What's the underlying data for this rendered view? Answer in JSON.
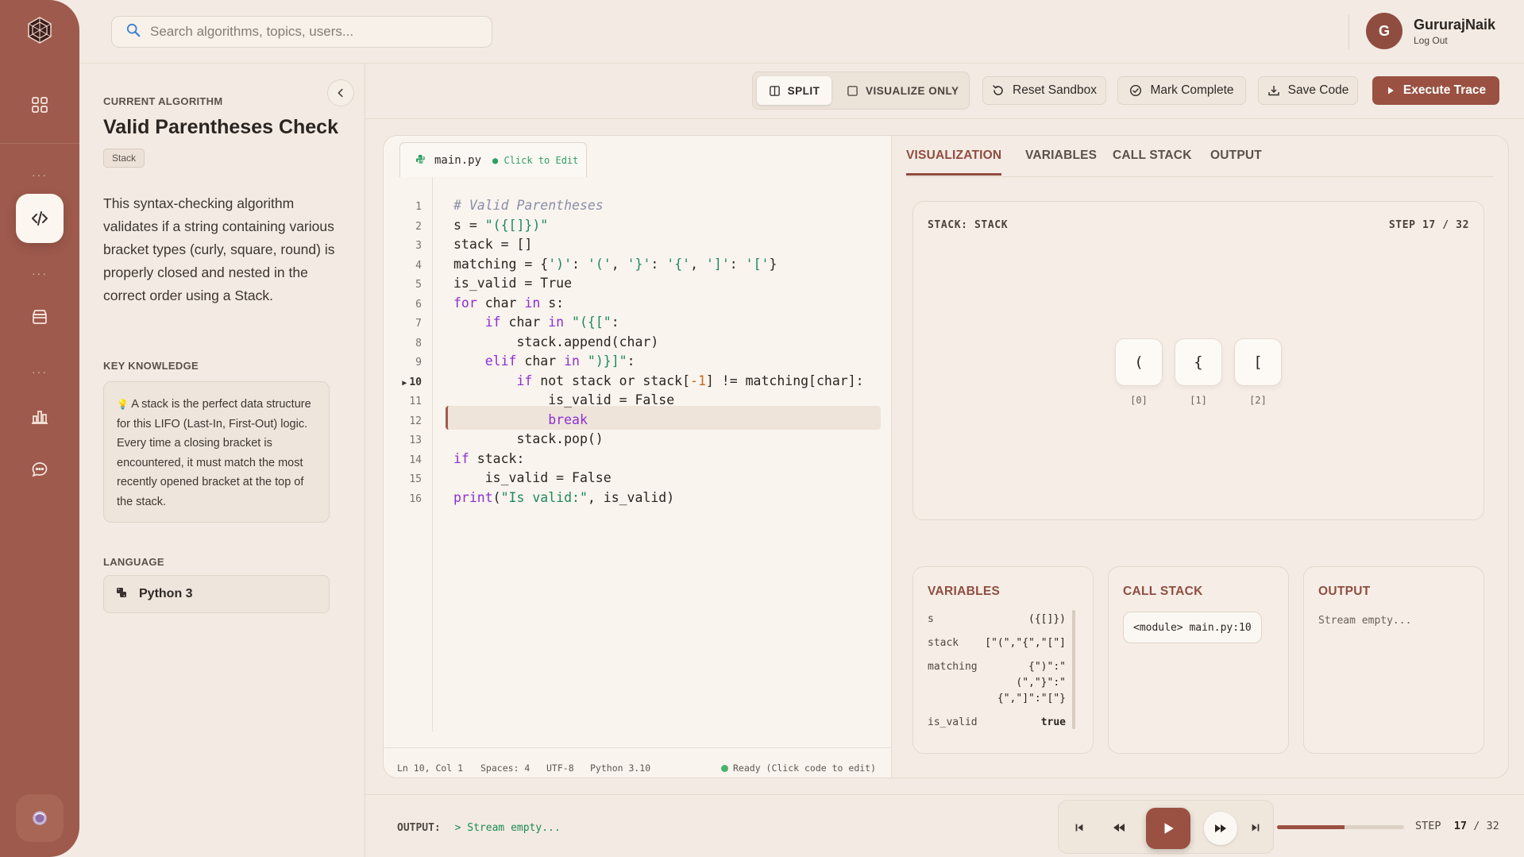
{
  "search": {
    "placeholder": "Search algorithms, topics, users..."
  },
  "user": {
    "initial": "G",
    "name": "GururajNaik",
    "action": "Log Out"
  },
  "sidebar": {
    "items": [
      "dashboard-icon",
      "code-icon",
      "archive-icon",
      "chart-icon",
      "chat-icon",
      "profile-icon"
    ],
    "dots": "···"
  },
  "left_panel": {
    "current_label": "CURRENT ALGORITHM",
    "title": "Valid Parentheses Check",
    "tag": "Stack",
    "description": "This syntax-checking algorithm validates if a string containing various bracket types (curly, square, round) is properly closed and nested in the correct order using a Stack.",
    "knowledge_label": "KEY KNOWLEDGE",
    "knowledge_icon": "💡",
    "knowledge_text": "A stack is the perfect data structure for this LIFO (Last-In, First-Out) logic. Every time a closing bracket is encountered, it must match the most recently opened bracket at the top of the stack.",
    "language_label": "LANGUAGE",
    "language": "Python 3"
  },
  "toolbar": {
    "split": "SPLIT",
    "visualize_only": "VISUALIZE ONLY",
    "reset": "Reset Sandbox",
    "mark_complete": "Mark Complete",
    "save": "Save Code",
    "execute": "Execute Trace"
  },
  "editor": {
    "filename": "main.py",
    "edit_hint": "● Click to Edit",
    "current_line": 10,
    "status": {
      "position": "Ln 10, Col 1",
      "spaces": "Spaces: 4",
      "encoding": "UTF-8",
      "version": "Python 3.10",
      "ready": "Ready (Click code to edit)"
    }
  },
  "viz": {
    "tabs": [
      "VISUALIZATION",
      "VARIABLES",
      "CALL STACK",
      "OUTPUT"
    ],
    "stack_title": "STACK: STACK",
    "step_label": "STEP 17 / 32",
    "stack_items": [
      "(",
      "{",
      "["
    ],
    "stack_indices": [
      "[0]",
      "[1]",
      "[2]"
    ]
  },
  "variables": {
    "title": "VARIABLES",
    "rows": [
      {
        "name": "s",
        "value": "({[]})"
      },
      {
        "name": "stack",
        "value": "[\"(\",\"{\",\"[\"]"
      },
      {
        "name": "matching",
        "value": "{\")\":\"",
        "value2": "(\",\"}\":\"",
        "value3": "{\",\"]\":\"[\"}"
      },
      {
        "name": "is_valid",
        "value": "true"
      }
    ]
  },
  "call_stack": {
    "title": "CALL STACK",
    "frame": "<module> main.py:10"
  },
  "output_panel": {
    "title": "OUTPUT",
    "text": "Stream empty..."
  },
  "bottom": {
    "output_label": "OUTPUT:",
    "output_value": "> Stream empty...",
    "step_word": "STEP",
    "step_current": "17",
    "step_sep": "/",
    "step_total": "32",
    "progress": 0.53
  },
  "colors": {
    "accent": "#9a5142",
    "sidebar": "#9e5a4c",
    "string": "#1d8a55",
    "keyword": "#8a2fd2"
  }
}
